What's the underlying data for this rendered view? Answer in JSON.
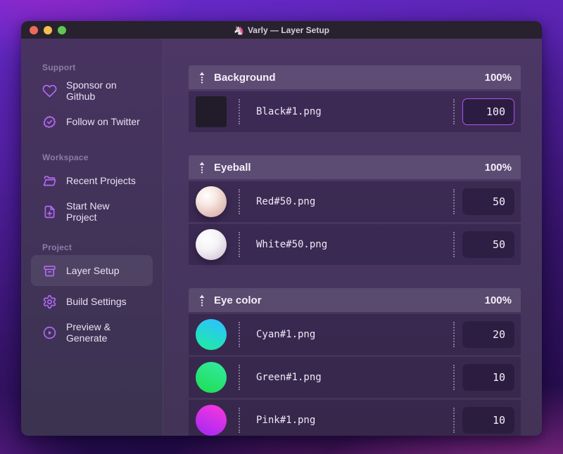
{
  "window": {
    "title": "Varly — Layer Setup",
    "icon": "🦄"
  },
  "titlebar": {
    "traffic_lights": [
      "close",
      "minimize",
      "zoom"
    ]
  },
  "sidebar": {
    "sections": [
      {
        "label": "Support",
        "items": [
          {
            "icon": "heart-icon",
            "label": "Sponsor on Github"
          },
          {
            "icon": "badge-check-icon",
            "label": "Follow on Twitter"
          }
        ]
      },
      {
        "label": "Workspace",
        "items": [
          {
            "icon": "folder-icon",
            "label": "Recent Projects"
          },
          {
            "icon": "file-plus-icon",
            "label": "Start New Project"
          }
        ]
      },
      {
        "label": "Project",
        "items": [
          {
            "icon": "archive-icon",
            "label": "Layer Setup",
            "active": true
          },
          {
            "icon": "gear-icon",
            "label": "Build Settings"
          },
          {
            "icon": "play-circle-icon",
            "label": "Preview & Generate"
          }
        ]
      }
    ]
  },
  "layers": {
    "groups": [
      {
        "name": "Background",
        "weight": "100%",
        "rows": [
          {
            "thumb": "black-swatch",
            "file": "Black#1.png",
            "value": "100",
            "focused": true
          }
        ]
      },
      {
        "name": "Eyeball",
        "weight": "100%",
        "rows": [
          {
            "thumb": "red-sphere",
            "file": "Red#50.png",
            "value": "50"
          },
          {
            "thumb": "white-sphere",
            "file": "White#50.png",
            "value": "50"
          }
        ]
      },
      {
        "name": "Eye color",
        "weight": "100%",
        "rows": [
          {
            "thumb": "cyan-sphere",
            "file": "Cyan#1.png",
            "value": "20"
          },
          {
            "thumb": "green-sphere",
            "file": "Green#1.png",
            "value": "10"
          },
          {
            "thumb": "pink-sphere",
            "file": "Pink#1.png",
            "value": "10"
          }
        ]
      }
    ]
  },
  "colors": {
    "accent_purple": "#b269f5",
    "focus_border": "#a957f2",
    "titlebar_bg": "#27222e",
    "sidebar_bg": "#44335a",
    "main_bg": "#48355f",
    "traffic_red": "#ec6a5e",
    "traffic_yellow": "#f5bf4f",
    "traffic_green": "#61c454"
  }
}
